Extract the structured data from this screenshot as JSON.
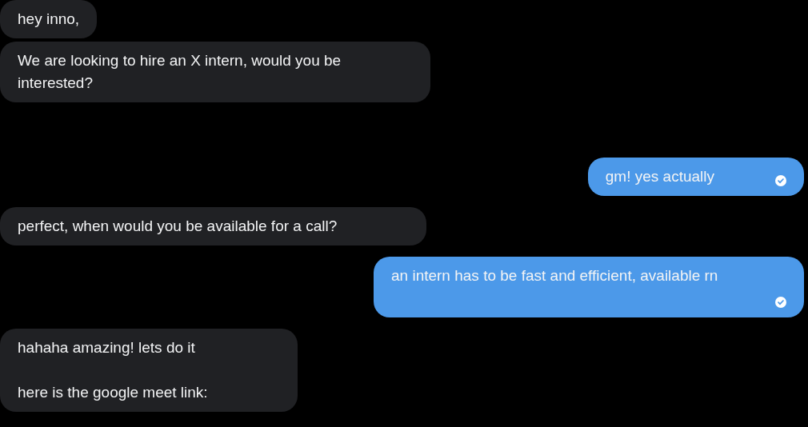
{
  "messages": [
    {
      "kind": "incoming",
      "text": "hey inno,"
    },
    {
      "kind": "incoming",
      "text": "We are looking to hire an X intern, would you be interested?"
    },
    {
      "kind": "outgoing",
      "text": "gm! yes actually",
      "read": true
    },
    {
      "kind": "incoming",
      "text": "perfect, when would you be available for a call?"
    },
    {
      "kind": "outgoing",
      "text": "an intern has to be fast and efficient, available rn",
      "read": true
    },
    {
      "kind": "incoming",
      "text": "hahaha amazing! lets do it\n\nhere is the google meet link:"
    }
  ]
}
